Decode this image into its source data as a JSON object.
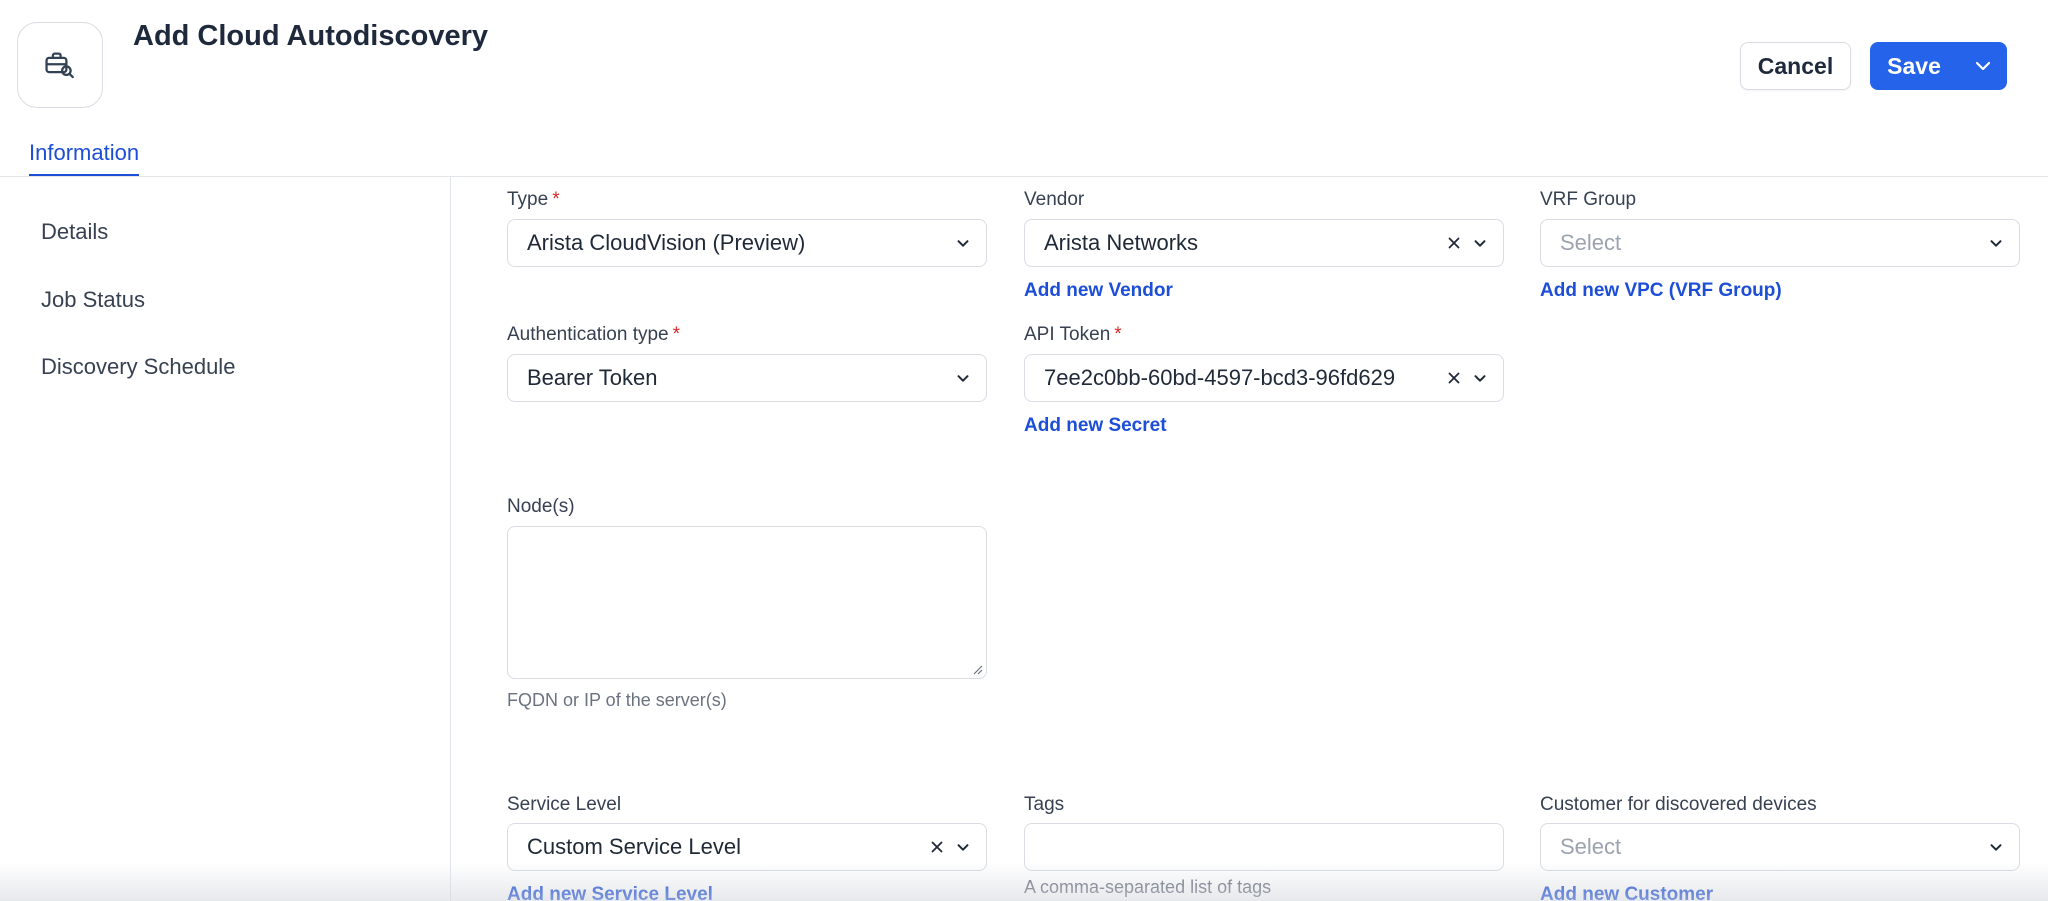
{
  "header": {
    "title": "Add Cloud Autodiscovery",
    "icon": "briefcase-search-icon",
    "cancel_label": "Cancel",
    "save_label": "Save"
  },
  "tabs": [
    {
      "label": "Information",
      "active": true
    }
  ],
  "sidebar": {
    "items": [
      {
        "label": "Details"
      },
      {
        "label": "Job Status"
      },
      {
        "label": "Discovery Schedule"
      }
    ]
  },
  "form": {
    "type": {
      "label": "Type",
      "value": "Arista CloudVision (Preview)",
      "required": "*"
    },
    "vendor": {
      "label": "Vendor",
      "value": "Arista Networks",
      "link": "Add new Vendor"
    },
    "vrf_group": {
      "label": "VRF Group",
      "placeholder": "Select",
      "link": "Add new VPC (VRF Group)"
    },
    "auth_type": {
      "label": "Authentication type",
      "value": "Bearer Token",
      "required": "*"
    },
    "api_token": {
      "label": "API Token",
      "value": "7ee2c0bb-60bd-4597-bcd3-96fd629",
      "required": "*",
      "link": "Add new Secret"
    },
    "nodes": {
      "label": "Node(s)",
      "value": "",
      "help": "FQDN or IP of the server(s)"
    },
    "service_level": {
      "label": "Service Level",
      "value": "Custom Service Level",
      "link": "Add new Service Level"
    },
    "tags": {
      "label": "Tags",
      "value": "",
      "help": "A comma-separated list of tags"
    },
    "customer": {
      "label": "Customer for discovered devices",
      "placeholder": "Select",
      "link": "Add new Customer"
    }
  },
  "colors": {
    "accent": "#2563eb",
    "link": "#1d4ed8",
    "required": "#dc2626",
    "border": "#d9dde3"
  }
}
